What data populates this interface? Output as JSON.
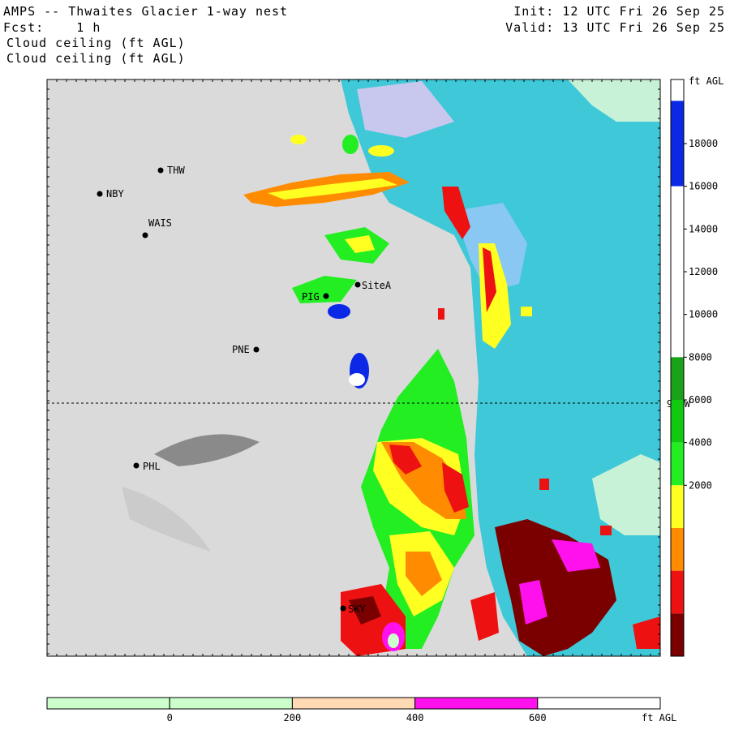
{
  "header": {
    "title": "AMPS -- Thwaites Glacier 1-way nest",
    "fcst_label": "Fcst:",
    "fcst_value": "1 h",
    "field_line1": "Cloud ceiling (ft AGL)",
    "field_line2": "Cloud ceiling (ft AGL)",
    "init": "Init: 12 UTC Fri 26 Sep 25",
    "valid": "Valid: 13 UTC Fri 26 Sep 25"
  },
  "map": {
    "meridian_label": "90 W",
    "stations": [
      {
        "id": "THW"
      },
      {
        "id": "NBY"
      },
      {
        "id": "WAIS"
      },
      {
        "id": "SiteA"
      },
      {
        "id": "PIG"
      },
      {
        "id": "PNE"
      },
      {
        "id": "PHL"
      },
      {
        "id": "SKY"
      }
    ]
  },
  "right_colorbar": {
    "unit": "ft AGL",
    "ticks": [
      "18000",
      "16000",
      "14000",
      "12000",
      "10000",
      "8000",
      "6000",
      "4000",
      "2000"
    ],
    "colors": [
      "#ffffff",
      "#0a28e6",
      "#0a28e6",
      "#ffffff",
      "#ffffff",
      "#ffffff",
      "#ffffff",
      "#1aa31a",
      "#12c912",
      "#22ee22",
      "#ffff22",
      "#ff8c00",
      "#ee1111",
      "#7a0000"
    ]
  },
  "bottom_colorbar": {
    "unit": "ft AGL",
    "ticks": [
      "0",
      "200",
      "400",
      "600"
    ],
    "colors": [
      "#ccffcc",
      "#ccffcc",
      "#ffd9b3",
      "#ff11ee",
      "#ffffff"
    ]
  }
}
